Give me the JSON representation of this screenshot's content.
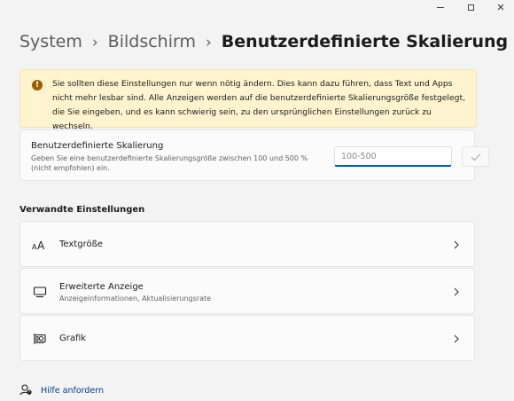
{
  "window": {
    "minimize_icon": "minimize-icon",
    "maximize_icon": "maximize-icon",
    "close_icon": "close-icon",
    "close_glyph": "✕"
  },
  "breadcrumb": {
    "items": [
      "System",
      "Bildschirm"
    ],
    "separator": "›",
    "current": "Benutzerdefinierte Skalierung"
  },
  "warning": {
    "icon": "warning-icon",
    "icon_glyph": "!",
    "text": "Sie sollten diese Einstellungen nur wenn nötig ändern. Dies kann dazu führen, dass Text und Apps nicht mehr lesbar sind. Alle Anzeigen werden auf die benutzerdefinierte Skalierungsgröße festgelegt, die Sie eingeben, und es kann schwierig sein, zu den ursprünglichen Einstellungen zurück zu wechseln."
  },
  "custom_scaling": {
    "title": "Benutzerdefinierte Skalierung",
    "description": "Geben Sie eine benutzerdefinierte Skalierungsgröße zwischen 100 und 500 % (nicht empfohlen) ein.",
    "input_value": "",
    "input_placeholder": "100-500",
    "apply_icon": "checkmark-icon"
  },
  "related": {
    "heading": "Verwandte Einstellungen",
    "items": [
      {
        "label": "Textgröße",
        "sublabel": "",
        "icon": "text-size-icon"
      },
      {
        "label": "Erweiterte Anzeige",
        "sublabel": "Anzeigeinformationen, Aktualisierungsrate",
        "icon": "monitor-icon"
      },
      {
        "label": "Grafik",
        "sublabel": "",
        "icon": "graphics-card-icon"
      }
    ]
  },
  "help": {
    "label": "Hilfe anfordern",
    "icon": "help-person-icon"
  },
  "colors": {
    "accent": "#005fb8",
    "warning_bg": "#fff4ce",
    "warning_icon": "#9d5d00",
    "link": "#003e92"
  }
}
